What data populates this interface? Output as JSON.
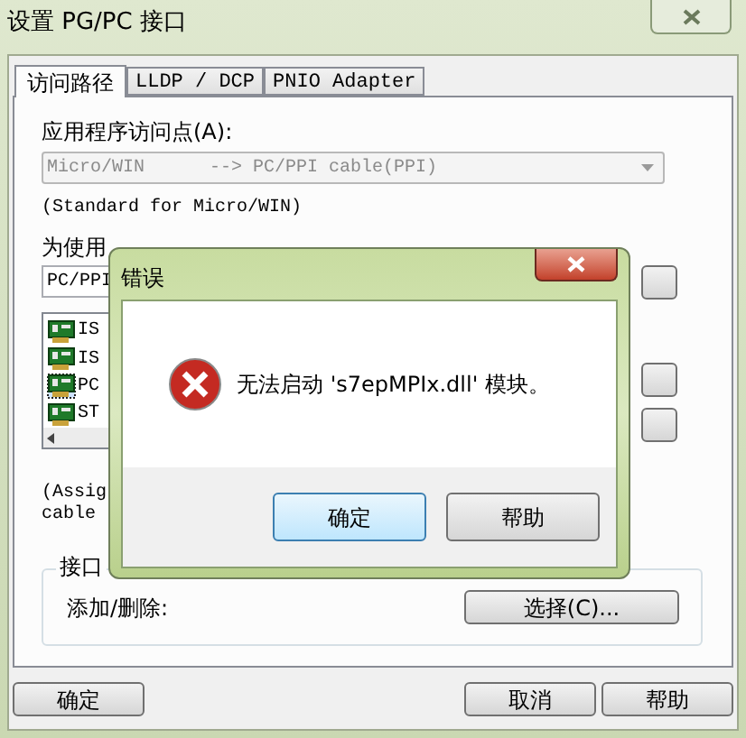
{
  "window": {
    "title": "设置 PG/PC 接口"
  },
  "tabs": [
    {
      "label": "访问路径",
      "selected": true
    },
    {
      "label": "LLDP / DCP",
      "selected": false
    },
    {
      "label": "PNIO Adapter",
      "selected": false
    }
  ],
  "access_point": {
    "label": "应用程序访问点(A):",
    "value": "Micro/WIN      --> PC/PPI cable(PPI)",
    "disabled": true
  },
  "description": "(Standard for Micro/WIN)",
  "params_label": "为使用",
  "params_field": "PC/PPI",
  "interfaces": [
    {
      "name": "IS",
      "selected": false
    },
    {
      "name": "IS",
      "selected": false
    },
    {
      "name": "PC",
      "selected": true
    },
    {
      "name": "ST",
      "selected": false
    }
  ],
  "assign_text": [
    "(Assig",
    "cable"
  ],
  "interface_group": {
    "title": "接口",
    "label": "添加/删除:",
    "button": "选择(C)..."
  },
  "buttons": [
    "确定",
    "取消",
    "帮助"
  ],
  "error_dialog": {
    "title": "错误",
    "message": "无法启动 's7epMPIx.dll' 模块。",
    "buttons": [
      {
        "label": "确定",
        "default": true
      },
      {
        "label": "帮助",
        "default": false
      }
    ]
  }
}
